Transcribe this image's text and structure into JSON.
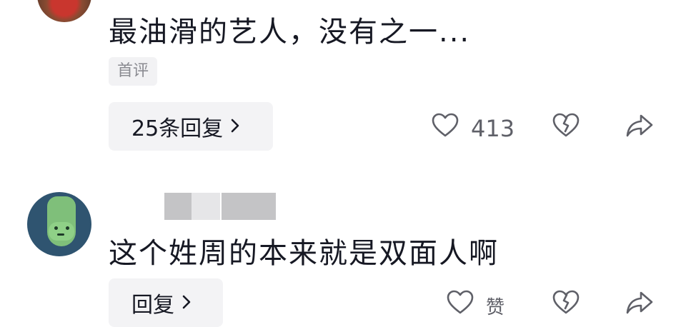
{
  "comments": [
    {
      "text": "最油滑的艺人，没有之一...",
      "badge": "首评",
      "reply_label": "25条回复",
      "like_count": "413"
    },
    {
      "text": "这个姓周的本来就是双面人啊",
      "reply_label": "回复",
      "like_label": "赞"
    }
  ],
  "icons": {
    "reply_chevron": "chevron-right-icon",
    "like": "heart-icon",
    "dislike": "broken-heart-icon",
    "share": "share-arrow-icon"
  },
  "colors": {
    "text": "#161823",
    "secondary": "#5f6068",
    "button_bg": "#f3f3f5"
  }
}
